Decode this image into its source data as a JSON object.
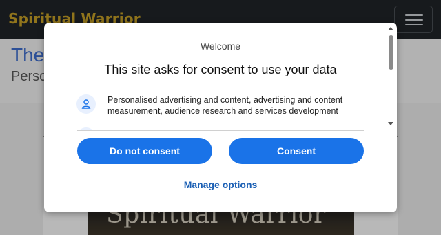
{
  "site": {
    "brand": "Spiritual Warrior",
    "hero_title": "The",
    "hero_subtitle": "Perso",
    "cover_text": "Spiritual Warrior"
  },
  "consent": {
    "welcome": "Welcome",
    "title": "This site asks for consent to use your data",
    "purpose_text": "Personalised advertising and content, advertising and content measurement, audience research and services development",
    "purpose_icon": "person-icon",
    "do_not_consent": "Do not consent",
    "consent": "Consent",
    "manage_options": "Manage options"
  },
  "colors": {
    "header_bg": "#212529",
    "brand": "#c9a227",
    "button_blue": "#1a73e8",
    "link_blue": "#1a5fb4",
    "hero_title": "#3f6fd1"
  }
}
